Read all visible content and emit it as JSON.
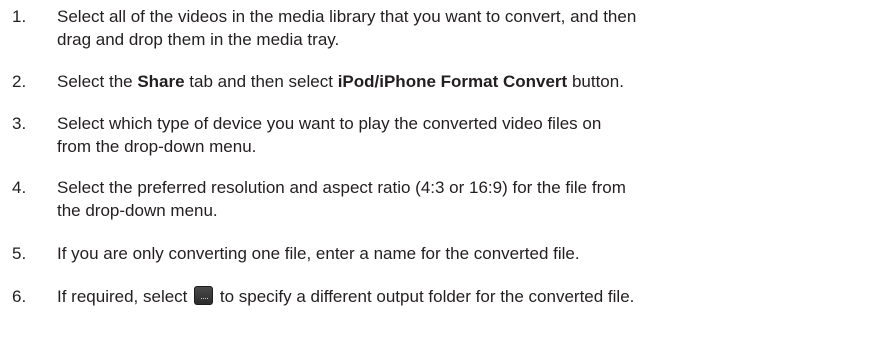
{
  "steps": [
    {
      "number": "1.",
      "lines": [
        "Select all of the videos in the media library that you want to convert, and then",
        "drag and drop them in the media tray."
      ]
    },
    {
      "number": "2.",
      "parts": {
        "a": "Select the ",
        "b_share": "Share",
        "c": " tab and then select ",
        "d_convert": "iPod/iPhone Format Convert",
        "e": " button."
      }
    },
    {
      "number": "3.",
      "lines": [
        "Select which type of device you want to play the converted video files on",
        "from the drop-down menu."
      ]
    },
    {
      "number": "4.",
      "lines": [
        "Select the preferred resolution and aspect ratio (4:3 or 16:9) for the file from",
        "the drop-down menu."
      ]
    },
    {
      "number": "5.",
      "lines": [
        "If you are only converting one file, enter a name for the converted file."
      ]
    },
    {
      "number": "6.",
      "parts": {
        "a": "If required, select ",
        "icon": "browse-folder-icon",
        "b": " to specify a different output folder for the converted file."
      }
    }
  ]
}
